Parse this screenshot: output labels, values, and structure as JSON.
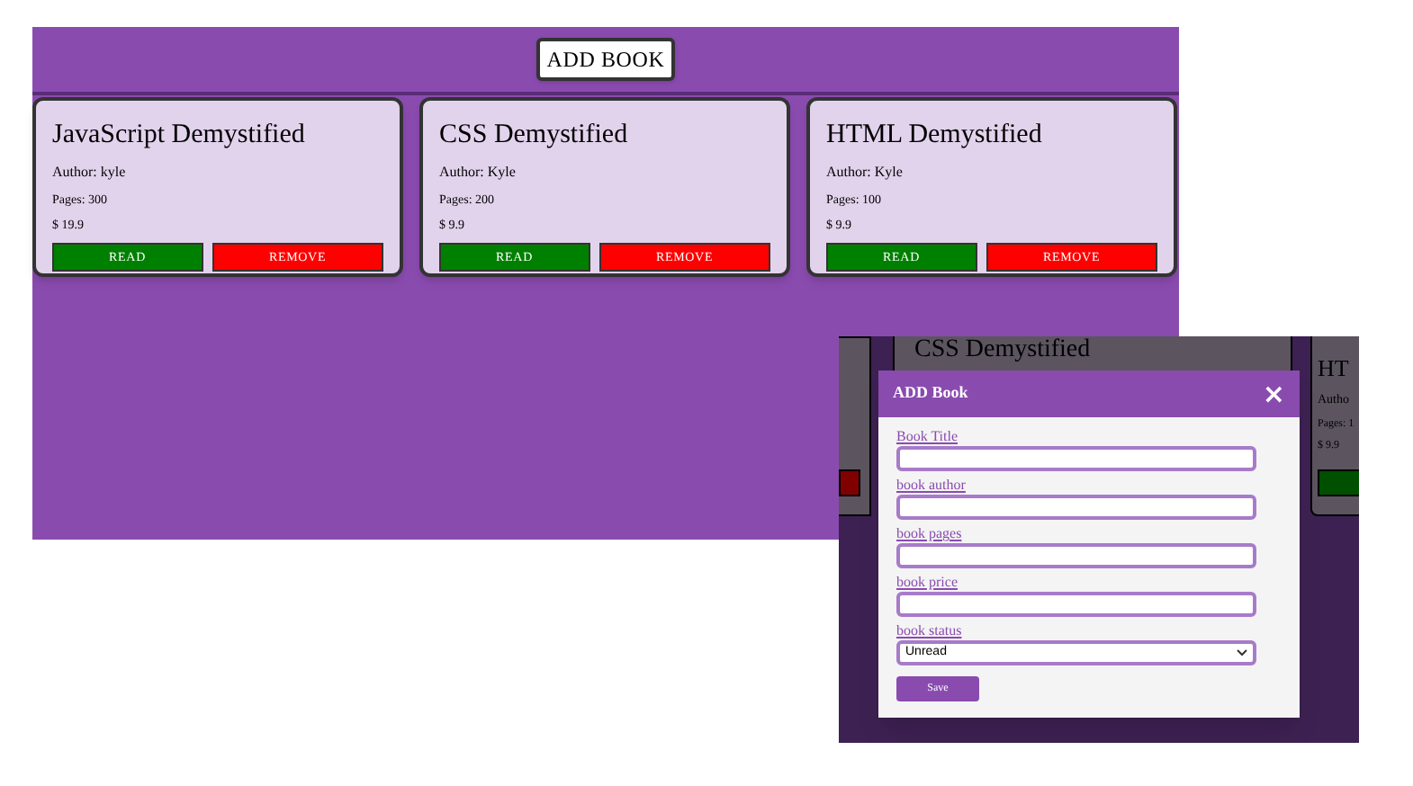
{
  "main": {
    "add_button": "ADD BOOK",
    "books": [
      {
        "title": "JavaScript Demystified",
        "author": "Author: kyle",
        "pages": "Pages: 300",
        "price": "$ 19.9",
        "read_button": "READ",
        "remove_button": "REMOVE"
      },
      {
        "title": "CSS Demystified",
        "author": "Author: Kyle",
        "pages": "Pages: 200",
        "price": "$ 9.9",
        "read_button": "READ",
        "remove_button": "REMOVE"
      },
      {
        "title": "HTML Demystified",
        "author": "Author: Kyle",
        "pages": "Pages: 100",
        "price": "$ 9.9",
        "read_button": "READ",
        "remove_button": "REMOVE"
      }
    ]
  },
  "modal_screenshot": {
    "background_cards": {
      "middle_title": "CSS Demystified",
      "right_title": "HT",
      "right_author": "Autho",
      "right_pages": "Pages: 1",
      "right_price": "$ 9.9"
    },
    "modal": {
      "title": "ADD Book",
      "close": "×",
      "fields": [
        {
          "label": "Book Title",
          "kind": "text"
        },
        {
          "label": "book author",
          "kind": "text"
        },
        {
          "label": "book pages",
          "kind": "text"
        },
        {
          "label": "book price",
          "kind": "text"
        },
        {
          "label": "book status",
          "kind": "select",
          "value": "Unread"
        }
      ],
      "save": "Save"
    }
  }
}
